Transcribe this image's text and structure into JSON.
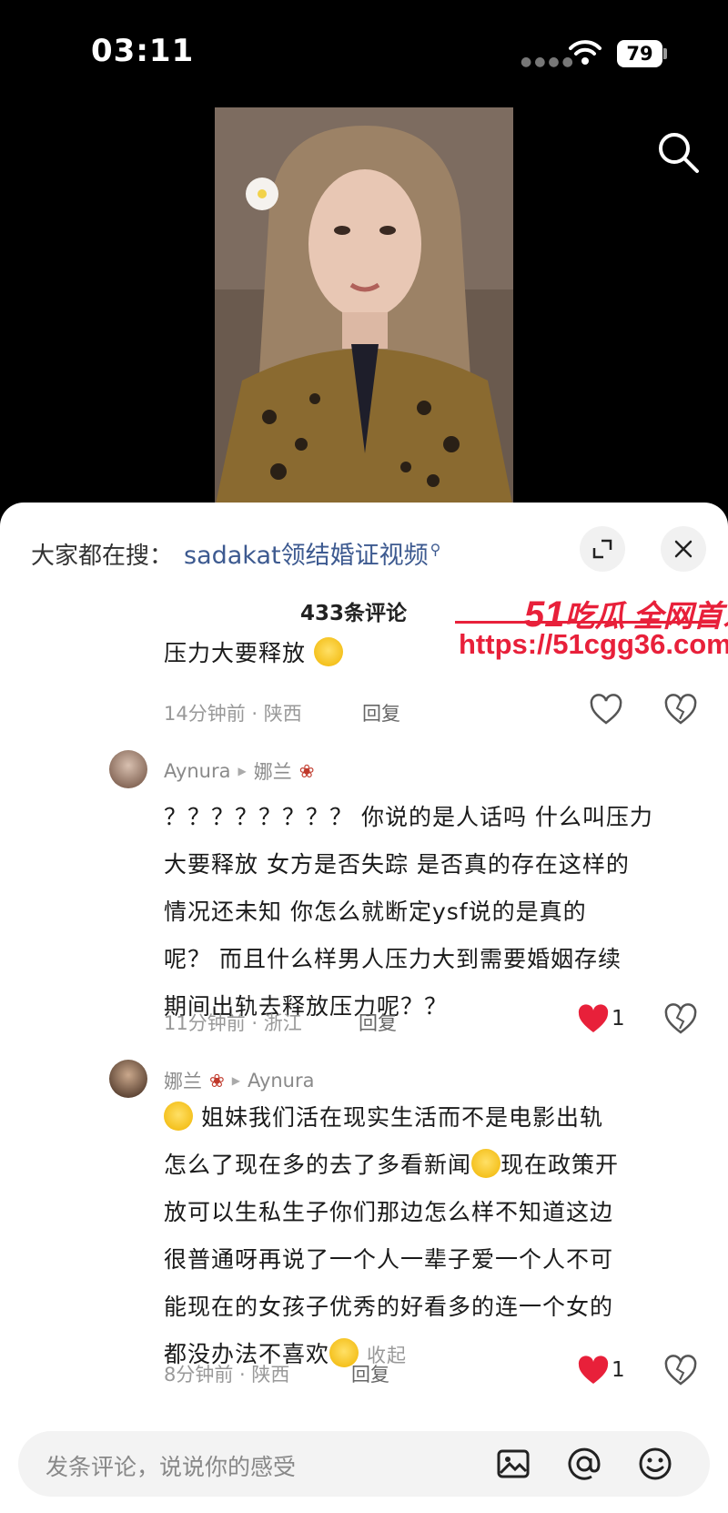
{
  "status_bar": {
    "time": "03:11",
    "battery": "79"
  },
  "video": {
    "search_icon": "search-icon"
  },
  "sheet": {
    "trend_label": "大家都在搜：",
    "trend_query": "sadakat领结婚证视频",
    "comment_count": "433条评论",
    "icons": [
      "expand-icon",
      "close-icon"
    ]
  },
  "watermark": {
    "brand_num": "51",
    "brand_text": "吃瓜 全网首发",
    "url": "https://51cgg36.com"
  },
  "comments": [
    {
      "text": "压力大要释放",
      "time_location": "14分钟前 · 陕西",
      "reply": "回复",
      "liked": false,
      "like_count": ""
    },
    {
      "user": "Aynura",
      "reply_to": "娜兰",
      "lines": [
        "？？？？？？？？ 你说的是人话吗  什么叫压力",
        "大要释放 女方是否失踪 是否真的存在这样的",
        "情况还未知 你怎么就断定ysf说的是真的",
        "呢？  而且什么样男人压力大到需要婚姻存续",
        "期间出轨去释放压力呢？？"
      ],
      "time_location": "11分钟前 · 浙江",
      "reply": "回复",
      "liked": true,
      "like_count": "1"
    },
    {
      "user": "娜兰",
      "reply_to": "Aynura",
      "lines": [
        "姐妹我们活在现实生活而不是电影出轨",
        "怎么了现在多的去了多看新闻",
        "现在政策开",
        "放可以生私生子你们那边怎么样不知道这边",
        "很普通呀再说了一个人一辈子爱一个人不可",
        "能现在的女孩子优秀的好看多的连一个女的",
        "都没办法不喜欢"
      ],
      "collapse": "收起",
      "time_location": "8分钟前 · 陕西",
      "reply": "回复",
      "liked": true,
      "like_count": "1"
    }
  ],
  "input_bar": {
    "placeholder": "发条评论，说说你的感受",
    "icons": [
      "image-icon",
      "at-icon",
      "emoji-icon"
    ]
  },
  "colors": {
    "like_red": "#e8203a",
    "link_blue": "#3d5a90",
    "watermark_red": "#e8203a"
  }
}
